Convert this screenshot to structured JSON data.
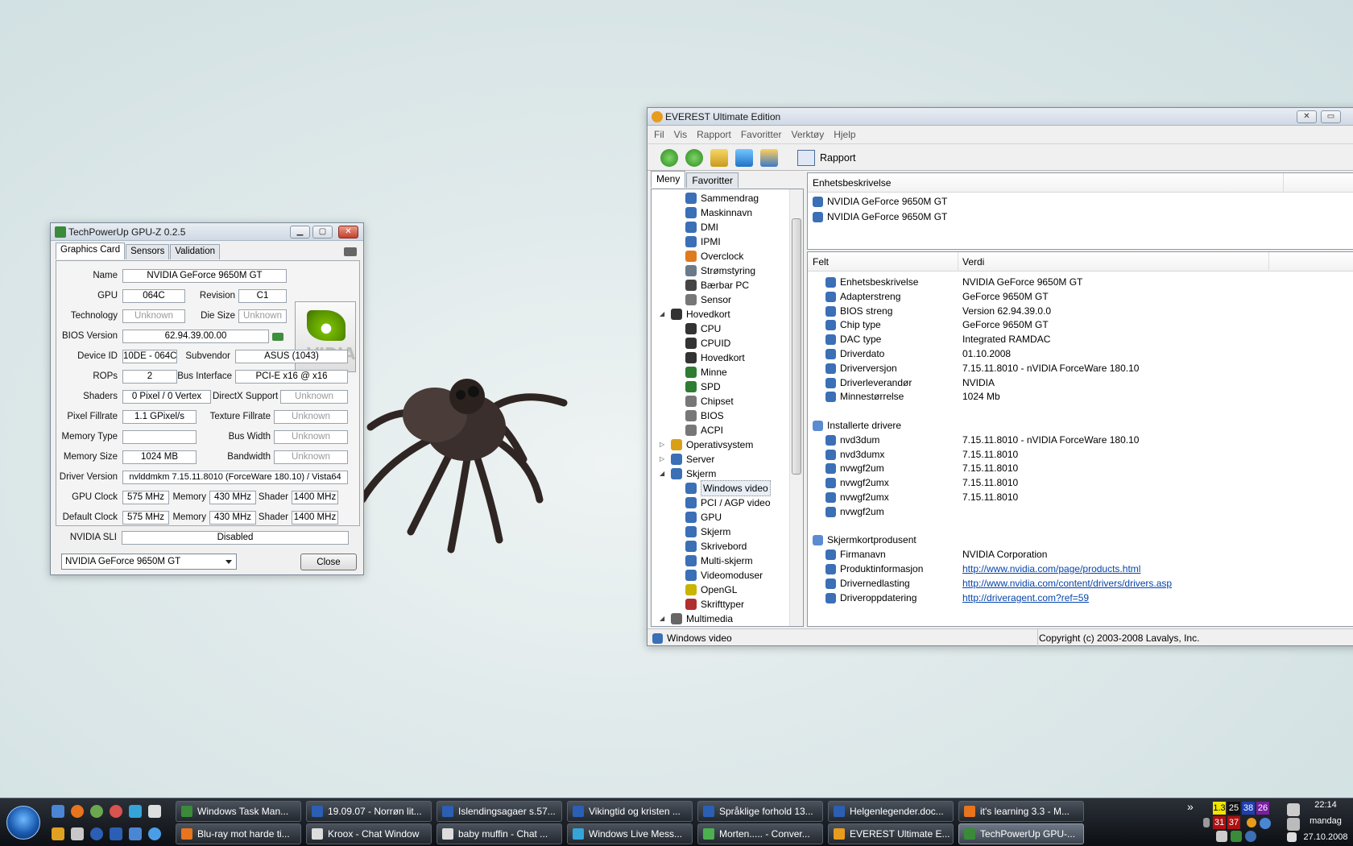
{
  "colors": {
    "nvidia_green": "#76b900",
    "link": "#0645ad",
    "taskbar": "#1c2026"
  },
  "gpuz": {
    "title": "TechPowerUp GPU-Z 0.2.5",
    "tabs": [
      "Graphics Card",
      "Sensors",
      "Validation"
    ],
    "logo_text": "nVIDIA",
    "fields": {
      "name_label": "Name",
      "name": "NVIDIA GeForce 9650M GT",
      "gpu_label": "GPU",
      "gpu": "064C",
      "revision_label": "Revision",
      "revision": "C1",
      "technology_label": "Technology",
      "technology": "Unknown",
      "die_size_label": "Die Size",
      "die_size": "Unknown",
      "bios_label": "BIOS Version",
      "bios": "62.94.39.00.00",
      "device_id_label": "Device ID",
      "device_id": "10DE - 064C",
      "subvendor_label": "Subvendor",
      "subvendor": "ASUS (1043)",
      "rops_label": "ROPs",
      "rops": "2",
      "bus_label": "Bus Interface",
      "bus": "PCI-E x16 @ x16",
      "shaders_label": "Shaders",
      "shaders": "0 Pixel / 0 Vertex",
      "directx_label": "DirectX Support",
      "directx": "Unknown",
      "pixel_label": "Pixel Fillrate",
      "pixel": "1.1 GPixel/s",
      "texture_label": "Texture Fillrate",
      "texture": "Unknown",
      "memtype_label": "Memory Type",
      "memtype": "",
      "buswidth_label": "Bus Width",
      "buswidth": "Unknown",
      "memsize_label": "Memory Size",
      "memsize": "1024 MB",
      "bandwidth_label": "Bandwidth",
      "bandwidth": "Unknown",
      "driver_label": "Driver Version",
      "driver": "nvlddmkm 7.15.11.8010 (ForceWare 180.10) / Vista64",
      "gpuclock_label": "GPU Clock",
      "gpuclock": "575 MHz",
      "memory_label": "Memory",
      "memclock": "430 MHz",
      "shader_label": "Shader",
      "shaderclock": "1400 MHz",
      "defclock_label": "Default Clock",
      "defclock": "575 MHz",
      "defmem": "430 MHz",
      "defshader": "1400 MHz",
      "sli_label": "NVIDIA SLI",
      "sli": "Disabled"
    },
    "selected_card": "NVIDIA GeForce 9650M GT",
    "close_label": "Close"
  },
  "everest": {
    "title": "EVEREST Ultimate Edition",
    "menu": [
      "Fil",
      "Vis",
      "Rapport",
      "Favoritter",
      "Verktøy",
      "Hjelp"
    ],
    "toolbar_report": "Rapport",
    "left_tabs": [
      "Meny",
      "Favoritter"
    ],
    "tree": [
      {
        "label": "Sammendrag",
        "level": 2,
        "color": "#3b6fb6"
      },
      {
        "label": "Maskinnavn",
        "level": 2,
        "color": "#3b6fb6"
      },
      {
        "label": "DMI",
        "level": 2,
        "color": "#3b6fb6"
      },
      {
        "label": "IPMI",
        "level": 2,
        "color": "#3b6fb6"
      },
      {
        "label": "Overclock",
        "level": 2,
        "color": "#e07a1f"
      },
      {
        "label": "Strømstyring",
        "level": 2,
        "color": "#6a7a8a"
      },
      {
        "label": "Bærbar PC",
        "level": 2,
        "color": "#444444"
      },
      {
        "label": "Sensor",
        "level": 2,
        "color": "#777777"
      },
      {
        "label": "Hovedkort",
        "level": 1,
        "color": "#333333",
        "exp": "◢"
      },
      {
        "label": "CPU",
        "level": 2,
        "color": "#333333"
      },
      {
        "label": "CPUID",
        "level": 2,
        "color": "#333333"
      },
      {
        "label": "Hovedkort",
        "level": 2,
        "color": "#333333"
      },
      {
        "label": "Minne",
        "level": 2,
        "color": "#2e7d32"
      },
      {
        "label": "SPD",
        "level": 2,
        "color": "#2e7d32"
      },
      {
        "label": "Chipset",
        "level": 2,
        "color": "#777777"
      },
      {
        "label": "BIOS",
        "level": 2,
        "color": "#777777"
      },
      {
        "label": "ACPI",
        "level": 2,
        "color": "#777777"
      },
      {
        "label": "Operativsystem",
        "level": 1,
        "color": "#d9a016",
        "exp": "▷"
      },
      {
        "label": "Server",
        "level": 1,
        "color": "#3b6fb6",
        "exp": "▷"
      },
      {
        "label": "Skjerm",
        "level": 1,
        "color": "#3b6fb6",
        "exp": "◢"
      },
      {
        "label": "Windows video",
        "level": 2,
        "color": "#3b6fb6",
        "selected": true
      },
      {
        "label": "PCI / AGP video",
        "level": 2,
        "color": "#3b6fb6"
      },
      {
        "label": "GPU",
        "level": 2,
        "color": "#3b6fb6"
      },
      {
        "label": "Skjerm",
        "level": 2,
        "color": "#3b6fb6"
      },
      {
        "label": "Skrivebord",
        "level": 2,
        "color": "#3b6fb6"
      },
      {
        "label": "Multi-skjerm",
        "level": 2,
        "color": "#3b6fb6"
      },
      {
        "label": "Videomoduser",
        "level": 2,
        "color": "#3b6fb6"
      },
      {
        "label": "OpenGL",
        "level": 2,
        "color": "#c9b400"
      },
      {
        "label": "Skrifttyper",
        "level": 2,
        "color": "#b03030"
      },
      {
        "label": "Multimedia",
        "level": 1,
        "color": "#666666",
        "exp": "◢"
      }
    ],
    "device_header": "Enhetsbeskrivelse",
    "devices": [
      "NVIDIA GeForce 9650M GT",
      "NVIDIA GeForce 9650M GT"
    ],
    "col_field": "Felt",
    "col_value": "Verdi",
    "rows": [
      {
        "f": "Enhetsbeskrivelse",
        "v": "NVIDIA GeForce 9650M GT",
        "indent": 1
      },
      {
        "f": "Adapterstreng",
        "v": "GeForce 9650M GT",
        "indent": 1
      },
      {
        "f": "BIOS streng",
        "v": "Version 62.94.39.0.0",
        "indent": 1
      },
      {
        "f": "Chip type",
        "v": "GeForce 9650M GT",
        "indent": 1
      },
      {
        "f": "DAC type",
        "v": "Integrated RAMDAC",
        "indent": 1
      },
      {
        "f": "Driverdato",
        "v": "01.10.2008",
        "indent": 1
      },
      {
        "f": "Driverversjon",
        "v": "7.15.11.8010 - nVIDIA ForceWare 180.10",
        "indent": 1
      },
      {
        "f": "Driverleverandør",
        "v": "NVIDIA",
        "indent": 1
      },
      {
        "f": "Minnestørrelse",
        "v": "1024 Mb",
        "indent": 1
      },
      {
        "f": "",
        "v": "",
        "indent": 0
      },
      {
        "f": "Installerte drivere",
        "v": "",
        "indent": 0
      },
      {
        "f": "nvd3dum",
        "v": "7.15.11.8010 - nVIDIA ForceWare 180.10",
        "indent": 1
      },
      {
        "f": "nvd3dumx",
        "v": "7.15.11.8010",
        "indent": 1
      },
      {
        "f": "nvwgf2um",
        "v": "7.15.11.8010",
        "indent": 1
      },
      {
        "f": "nvwgf2umx",
        "v": "7.15.11.8010",
        "indent": 1
      },
      {
        "f": "nvwgf2umx",
        "v": "7.15.11.8010",
        "indent": 1
      },
      {
        "f": "nvwgf2um",
        "v": "",
        "indent": 1
      },
      {
        "f": "",
        "v": "",
        "indent": 0
      },
      {
        "f": "Skjermkortprodusent",
        "v": "",
        "indent": 0
      },
      {
        "f": "Firmanavn",
        "v": "NVIDIA Corporation",
        "indent": 1
      },
      {
        "f": "Produktinformasjon",
        "v": "http://www.nvidia.com/page/products.html",
        "indent": 1,
        "link": true
      },
      {
        "f": "Drivernedlasting",
        "v": "http://www.nvidia.com/content/drivers/drivers.asp",
        "indent": 1,
        "link": true
      },
      {
        "f": "Driveroppdatering",
        "v": "http://driveragent.com?ref=59",
        "indent": 1,
        "link": true
      }
    ],
    "status_left": "Windows video",
    "status_right": "Copyright (c) 2003-2008 Lavalys, Inc."
  },
  "taskbar": {
    "row1": [
      {
        "label": "Windows Task Man...",
        "color": "#3a8a3a"
      },
      {
        "label": "19.09.07 - Norrøn lit...",
        "color": "#2b5fb4"
      },
      {
        "label": "Islendingsagaer s.57...",
        "color": "#2b5fb4"
      },
      {
        "label": "Vikingtid og kristen ...",
        "color": "#2b5fb4"
      },
      {
        "label": "Språklige forhold 13...",
        "color": "#2b5fb4"
      },
      {
        "label": "Helgenlegender.doc...",
        "color": "#2b5fb4"
      },
      {
        "label": "it's learning 3.3 - M...",
        "color": "#e8741e"
      }
    ],
    "row2": [
      {
        "label": "Blu-ray mot harde ti...",
        "color": "#e8741e"
      },
      {
        "label": "Kroox - Chat Window",
        "color": "#dddddd"
      },
      {
        "label": "baby muffin - Chat ...",
        "color": "#dddddd"
      },
      {
        "label": "Windows Live Mess...",
        "color": "#35a4d8"
      },
      {
        "label": "Morten..... - Conver...",
        "color": "#4caf50"
      },
      {
        "label": "EVEREST Ultimate E...",
        "color": "#e89b1d"
      },
      {
        "label": "TechPowerUp GPU-...",
        "color": "#3a8a3a",
        "active": true
      }
    ],
    "tray_chevron": "»",
    "tray_numbers_top": [
      {
        "v": "1.3",
        "bg": "#f2e600",
        "fg": "#000"
      },
      {
        "v": "25",
        "bg": "#111111",
        "fg": "#fff"
      },
      {
        "v": "38",
        "bg": "#1e3fb0",
        "fg": "#fff"
      },
      {
        "v": "26",
        "bg": "#7a1fa0",
        "fg": "#fff"
      }
    ],
    "tray_numbers_bottom": [
      {
        "v": "31",
        "bg": "#b01010",
        "fg": "#fff"
      },
      {
        "v": "37",
        "bg": "#b01010",
        "fg": "#fff"
      }
    ],
    "clock_time": "22:14",
    "clock_day": "mandag",
    "clock_date": "27.10.2008"
  }
}
